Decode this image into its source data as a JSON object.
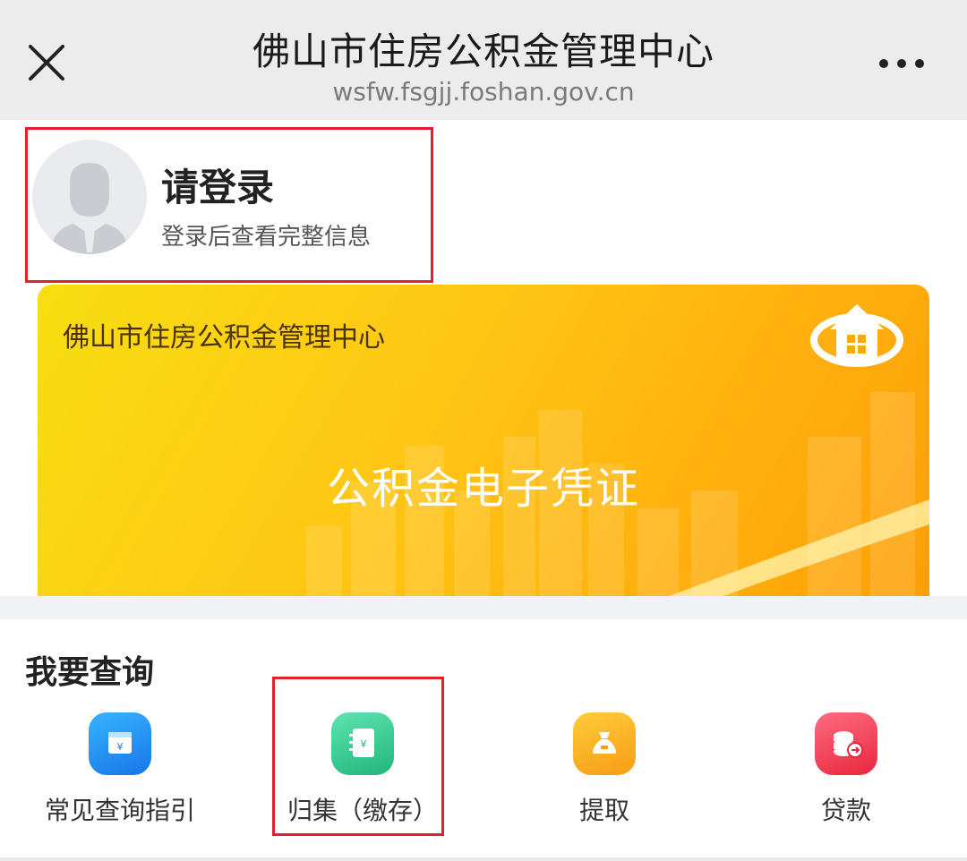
{
  "header": {
    "title": "佛山市住房公积金管理中心",
    "url": "wsfw.fsgjj.foshan.gov.cn",
    "close_icon": "close-icon",
    "more_icon": "more-icon"
  },
  "user": {
    "avatar_icon": "user-avatar-icon",
    "login_title": "请登录",
    "login_hint": "登录后查看完整信息"
  },
  "card": {
    "org_name": "佛山市住房公积金管理中心",
    "title": "公积金电子凭证",
    "logo_icon": "house-logo-icon"
  },
  "query": {
    "section_title": "我要查询",
    "items": [
      {
        "label": "常见查询指引",
        "icon": "notebook-yuan-icon",
        "color": "#1e8cf0"
      },
      {
        "label": "归集（缴存）",
        "icon": "ledger-yuan-icon",
        "color": "#2fc98d"
      },
      {
        "label": "提取",
        "icon": "money-bag-icon",
        "color": "#f8a91c"
      },
      {
        "label": "贷款",
        "icon": "coins-icon",
        "color": "#f03c54"
      }
    ]
  },
  "colors": {
    "highlight_border": "#e3202a",
    "card_gradient_start": "#f7de12",
    "card_gradient_end": "#fd9f08"
  }
}
